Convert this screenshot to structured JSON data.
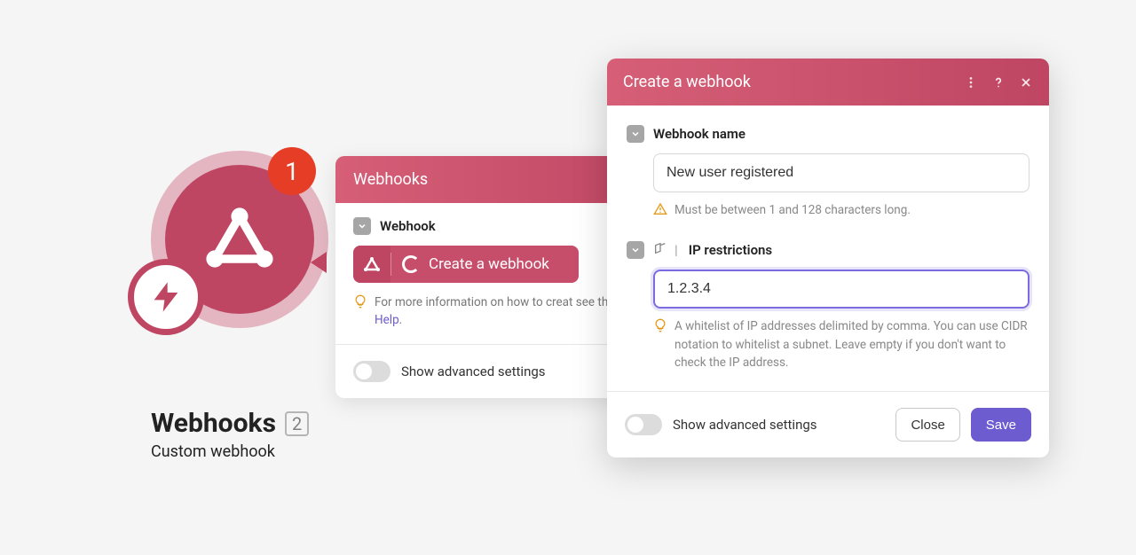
{
  "node": {
    "title": "Webhooks",
    "count": "2",
    "subtitle": "Custom webhook",
    "badge": "1"
  },
  "panel1": {
    "header": "Webhooks",
    "field_label": "Webhook",
    "chip_label": "Create a webhook",
    "hint_prefix": "For more information on how to creat see the ",
    "hint_link": "online Help",
    "hint_suffix": ".",
    "footer_label": "Show advanced settings"
  },
  "panel2": {
    "title": "Create a webhook",
    "field_name_label": "Webhook name",
    "field_name_value": "New user registered",
    "field_name_hint": "Must be between 1 and 128 characters long.",
    "field_ip_label": "IP restrictions",
    "field_ip_value": "1.2.3.4",
    "field_ip_hint": "A whitelist of IP addresses delimited by comma. You can use CIDR notation to whitelist a subnet. Leave empty if you don't want to check the IP address.",
    "footer_label": "Show advanced settings",
    "close_label": "Close",
    "save_label": "Save"
  }
}
